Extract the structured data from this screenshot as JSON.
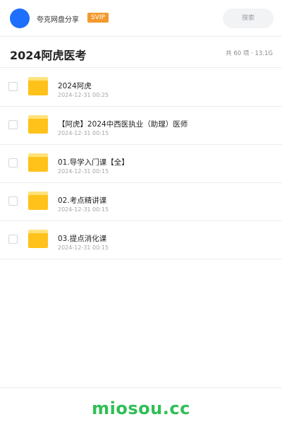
{
  "header": {
    "brand": "夸克网盘分享",
    "badge": "SVIP",
    "search_label": "搜索"
  },
  "folder": {
    "title": "2024阿虎医考",
    "meta": "共 60 项 · 13.1G"
  },
  "items": [
    {
      "name": "2024阿虎",
      "date": "2024-12-31 00:25"
    },
    {
      "name": "【阿虎】2024中西医执业（助理）医师",
      "date": "2024-12-31 00:15"
    },
    {
      "name": "01.导学入门课【全】",
      "date": "2024-12-31 00:15"
    },
    {
      "name": "02.考点精讲课",
      "date": "2024-12-31 00:15"
    },
    {
      "name": "03.提点消化课",
      "date": "2024-12-31 00:15"
    }
  ],
  "footer": {
    "watermark": "miosou.cc"
  },
  "colors": {
    "accent": "#1f6fff",
    "badge": "#f39a2e",
    "folder": "#ffc21a",
    "watermark": "#2fbf55"
  }
}
